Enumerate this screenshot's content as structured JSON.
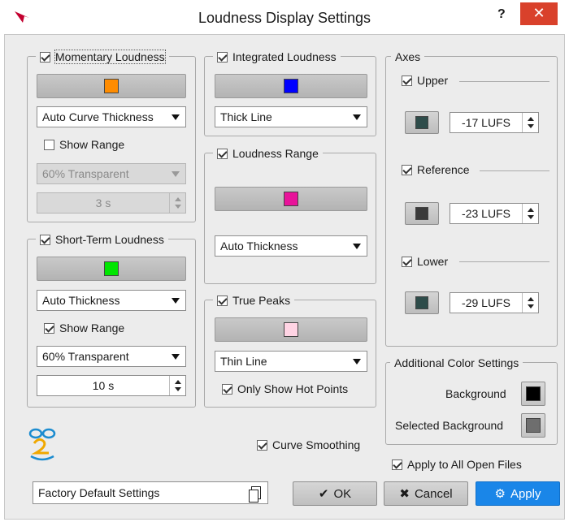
{
  "window": {
    "title": "Loudness Display Settings",
    "help": "?",
    "close": "✕"
  },
  "momentary": {
    "label": "Momentary Loudness",
    "checked": true,
    "color": "#ff8c00",
    "thickness": "Auto Curve Thickness",
    "show_range_label": "Show Range",
    "show_range": false,
    "transparency": "60% Transparent",
    "duration": "3 s"
  },
  "short_term": {
    "label": "Short-Term Loudness",
    "checked": true,
    "color": "#00e600",
    "thickness": "Auto Thickness",
    "show_range_label": "Show Range",
    "show_range": true,
    "transparency": "60% Transparent",
    "duration": "10 s"
  },
  "integrated": {
    "label": "Integrated Loudness",
    "checked": true,
    "color": "#0000ff",
    "thickness": "Thick Line"
  },
  "loudness_range": {
    "label": "Loudness Range",
    "checked": true,
    "color": "#e8139a",
    "thickness": "Auto Thickness"
  },
  "true_peaks": {
    "label": "True Peaks",
    "checked": true,
    "color": "#ffd4e4",
    "thickness": "Thin Line",
    "hot_points_label": "Only Show Hot Points",
    "hot_points": true
  },
  "axes": {
    "label": "Axes",
    "upper": {
      "label": "Upper",
      "checked": true,
      "color": "#2e4c4a",
      "value": "-17 LUFS"
    },
    "reference": {
      "label": "Reference",
      "checked": true,
      "color": "#3a3a3a",
      "value": "-23 LUFS"
    },
    "lower": {
      "label": "Lower",
      "checked": true,
      "color": "#2e4c4a",
      "value": "-29 LUFS"
    }
  },
  "additional": {
    "label": "Additional Color Settings",
    "background_label": "Background",
    "background_color": "#000000",
    "selected_background_label": "Selected Background",
    "selected_background_color": "#6e6e6e"
  },
  "curve_smoothing": {
    "label": "Curve Smoothing",
    "checked": true
  },
  "apply_all": {
    "label": "Apply to All Open Files",
    "checked": true
  },
  "preset": {
    "value": "Factory Default Settings"
  },
  "buttons": {
    "ok": "OK",
    "ok_icon": "✔",
    "cancel": "Cancel",
    "cancel_icon": "✖",
    "apply": "Apply",
    "apply_icon": "⚙"
  }
}
